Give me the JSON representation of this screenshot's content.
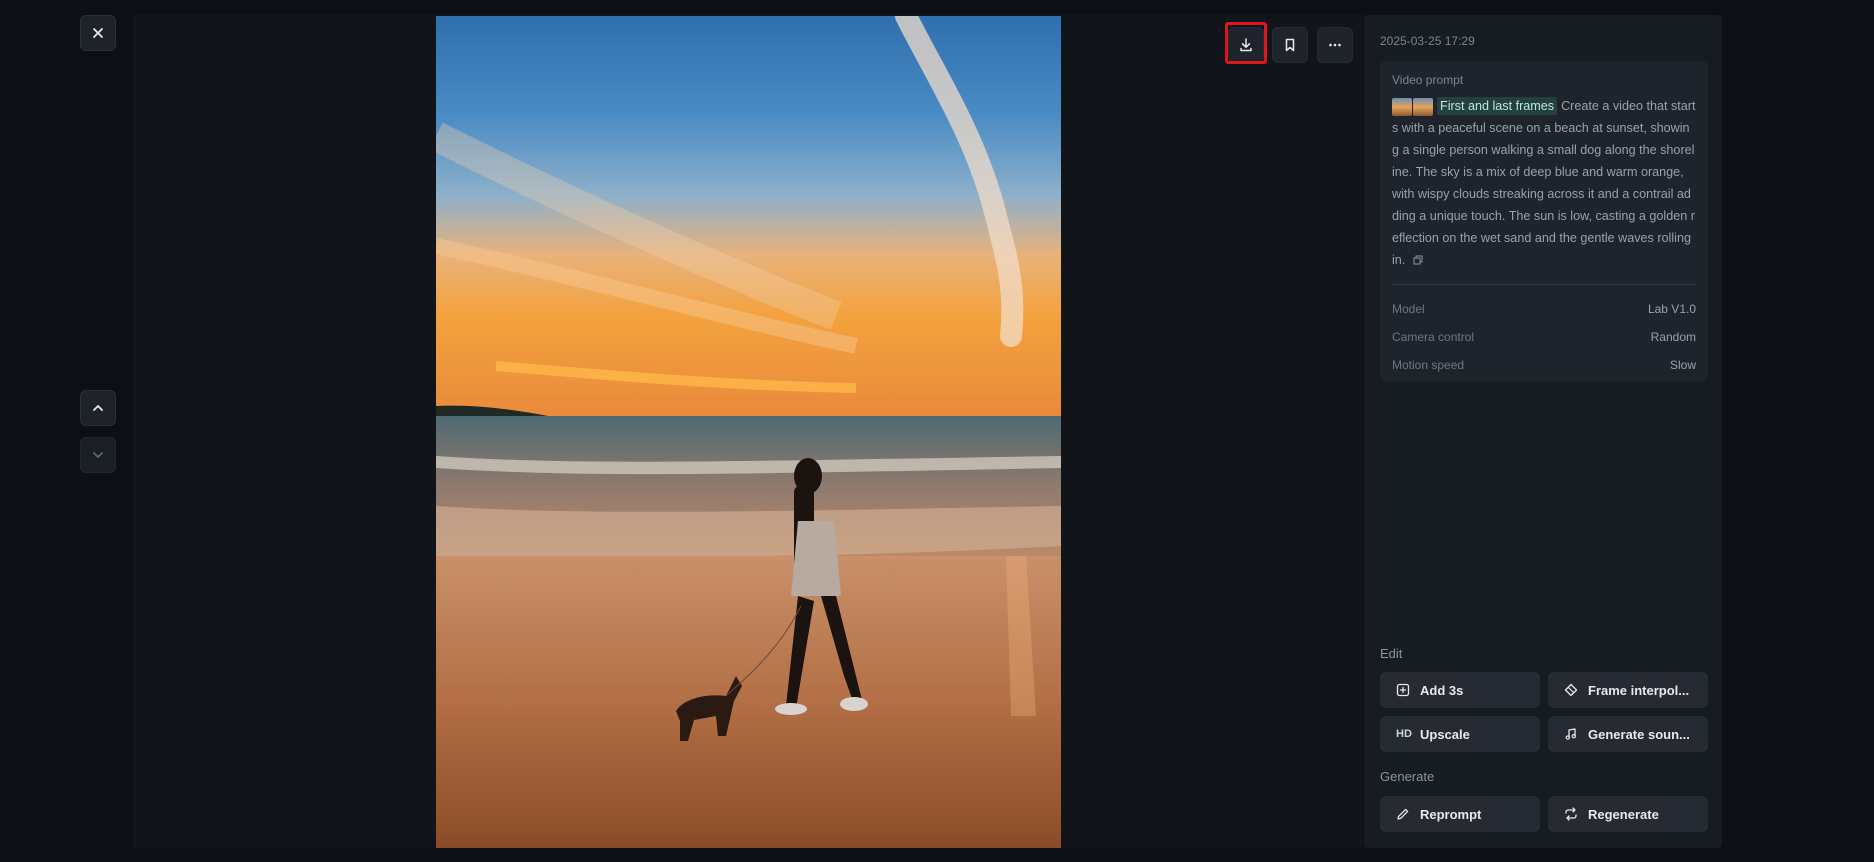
{
  "viewer": {
    "close_icon": "close-icon",
    "prev_icon": "chevron-up-icon",
    "next_icon": "chevron-down-icon"
  },
  "toolbar": {
    "download_icon": "download-icon",
    "bookmark_icon": "bookmark-icon",
    "more_icon": "more-icon",
    "highlight_color": "#e0141b"
  },
  "details": {
    "timestamp": "2025-03-25 17:29",
    "prompt_label": "Video prompt",
    "frames_tag": "First and last frames",
    "prompt_text": "Create a video that starts with a peaceful scene on a beach at sunset, showing a single person walking a small dog along the shoreline. The sky is a mix of deep blue and warm orange, with wispy clouds streaking across it and a contrail adding a unique touch. The sun is low, casting a golden reflection on the wet sand and the gentle waves rolling in.",
    "meta": [
      {
        "key": "Model",
        "value": "Lab V1.0"
      },
      {
        "key": "Camera control",
        "value": "Random"
      },
      {
        "key": "Motion speed",
        "value": "Slow"
      }
    ]
  },
  "edit": {
    "label": "Edit",
    "add": "Add 3s",
    "interpolation": "Frame interpol...",
    "upscale_badge": "HD",
    "upscale": "Upscale",
    "sound": "Generate soun..."
  },
  "generate": {
    "label": "Generate",
    "reprompt": "Reprompt",
    "regenerate": "Regenerate"
  }
}
